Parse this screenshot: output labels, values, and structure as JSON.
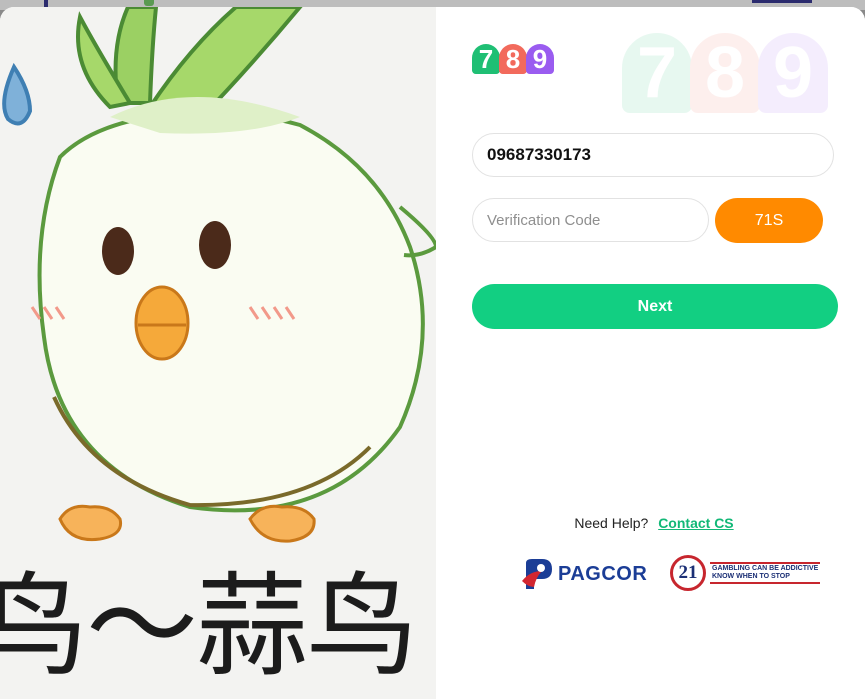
{
  "art": {
    "caption": "鸟～蒜鸟"
  },
  "logo": {
    "digits": [
      {
        "char": "7",
        "color": "#1fbf74"
      },
      {
        "char": "8",
        "color": "#f26a5c"
      },
      {
        "char": "9",
        "color": "#9a5cf0"
      }
    ]
  },
  "form": {
    "phone_value": "09687330173",
    "code_placeholder": "Verification Code",
    "countdown_label": "71S",
    "next_label": "Next"
  },
  "help": {
    "prompt": "Need Help?",
    "link_label": "Contact CS"
  },
  "partners": {
    "pagcor_label": "PAGCOR",
    "rg_age": "21",
    "rg_line1": "GAMBLING CAN BE ADDICTIVE",
    "rg_line2": "KNOW WHEN TO STOP"
  },
  "colors": {
    "accent_green": "#12cf82",
    "countdown_orange": "#ff8a00",
    "link_green": "#12b877"
  }
}
